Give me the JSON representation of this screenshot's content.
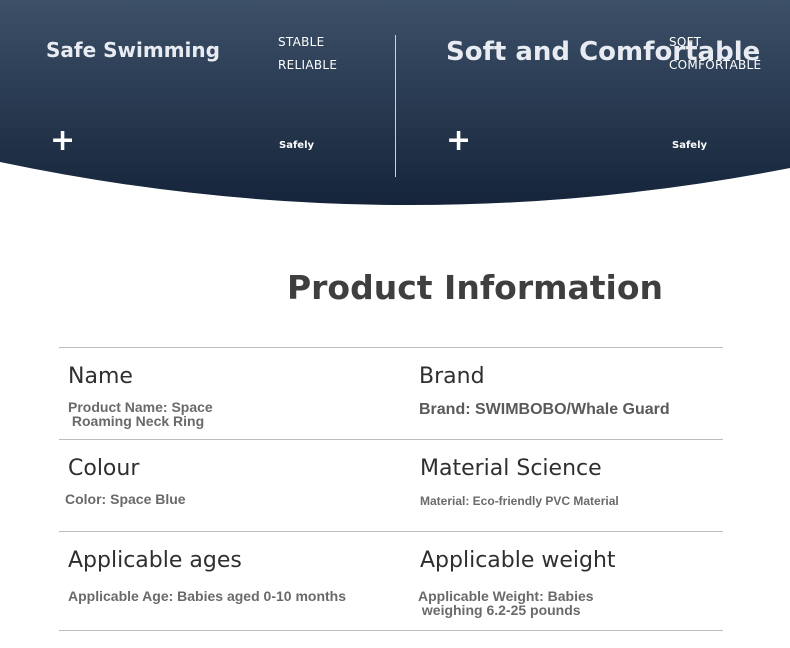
{
  "banner": {
    "left": {
      "title": "Safe Swimming",
      "line1": "STABLE",
      "line2": "RELIABLE",
      "plus": "+",
      "caption": "Safely"
    },
    "right": {
      "title": "Soft and Comfortable",
      "line1": "SOFT",
      "line2": "COMFORTABLE",
      "plus": "+",
      "caption": "Safely"
    },
    "colors": {
      "top": "#3c5068",
      "bottom": "#15243a"
    }
  },
  "section_title": "Product Information",
  "rows": [
    {
      "left_label": "Name",
      "left_value": "Product Name: Space\n Roaming Neck Ring",
      "right_label": "Brand",
      "right_value": "Brand: SWIMBOBO/Whale Guard"
    },
    {
      "left_label": "Colour",
      "left_value": "Color: Space Blue",
      "right_label": "Material Science",
      "right_value": "Material: Eco-friendly PVC Material"
    },
    {
      "left_label": "Applicable ages",
      "left_value": "Applicable Age: Babies aged 0-10 months",
      "right_label": "Applicable weight",
      "right_value": "Applicable Weight: Babies\n weighing 6.2-25 pounds"
    }
  ]
}
